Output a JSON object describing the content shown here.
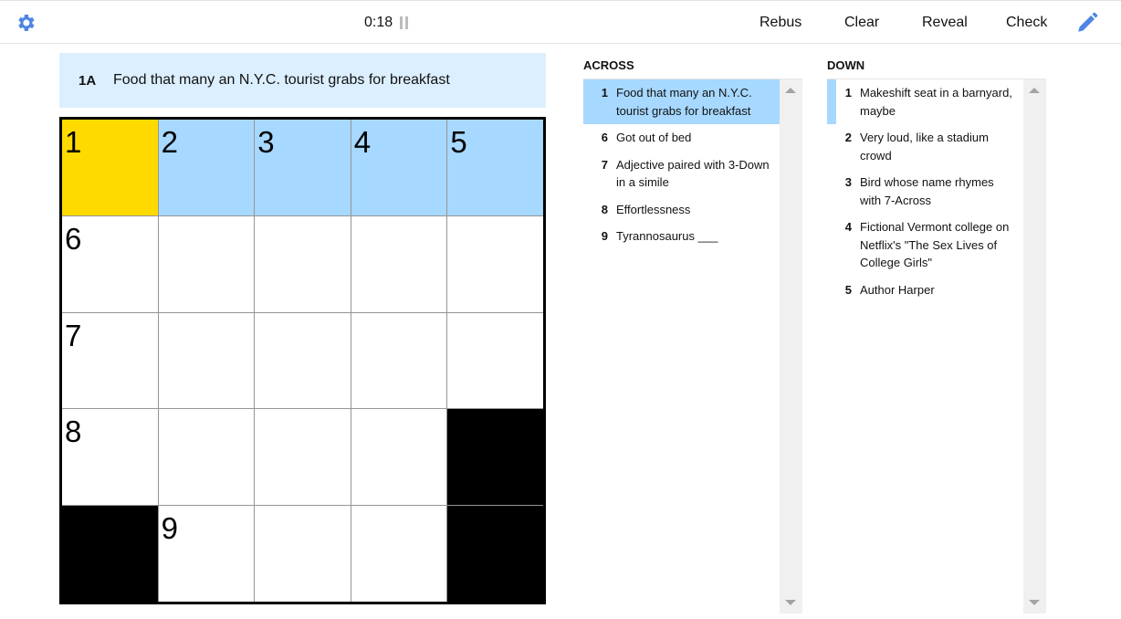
{
  "toolbar": {
    "settings_icon": "gear-icon",
    "timer": "0:18",
    "pause_icon": "pause-icon",
    "buttons": [
      "Rebus",
      "Clear",
      "Reveal",
      "Check"
    ],
    "pencil_icon": "pencil-icon",
    "accent_color": "#4f85e5"
  },
  "current_clue": {
    "label": "1A",
    "text": "Food that many an N.Y.C. tourist grabs for breakfast"
  },
  "grid": {
    "rows": 5,
    "cols": 5,
    "cells": [
      {
        "num": "1",
        "state": "selected"
      },
      {
        "num": "2",
        "state": "word"
      },
      {
        "num": "3",
        "state": "word"
      },
      {
        "num": "4",
        "state": "word"
      },
      {
        "num": "5",
        "state": "word"
      },
      {
        "num": "6",
        "state": "open"
      },
      {
        "num": "",
        "state": "open"
      },
      {
        "num": "",
        "state": "open"
      },
      {
        "num": "",
        "state": "open"
      },
      {
        "num": "",
        "state": "open"
      },
      {
        "num": "7",
        "state": "open"
      },
      {
        "num": "",
        "state": "open"
      },
      {
        "num": "",
        "state": "open"
      },
      {
        "num": "",
        "state": "open"
      },
      {
        "num": "",
        "state": "open"
      },
      {
        "num": "8",
        "state": "open"
      },
      {
        "num": "",
        "state": "open"
      },
      {
        "num": "",
        "state": "open"
      },
      {
        "num": "",
        "state": "open"
      },
      {
        "num": "",
        "state": "black"
      },
      {
        "num": "",
        "state": "black"
      },
      {
        "num": "9",
        "state": "open"
      },
      {
        "num": "",
        "state": "open"
      },
      {
        "num": "",
        "state": "open"
      },
      {
        "num": "",
        "state": "black"
      }
    ],
    "colors": {
      "selected": "#ffda00",
      "word": "#a7d8ff",
      "black": "#000000"
    }
  },
  "across": {
    "title": "ACROSS",
    "clues": [
      {
        "num": "1",
        "text": "Food that many an N.Y.C. tourist grabs for breakfast",
        "state": "active"
      },
      {
        "num": "6",
        "text": "Got out of bed",
        "state": ""
      },
      {
        "num": "7",
        "text": "Adjective paired with 3-Down in a simile",
        "state": ""
      },
      {
        "num": "8",
        "text": "Effortlessness",
        "state": ""
      },
      {
        "num": "9",
        "text": "Tyrannosaurus ___",
        "state": ""
      }
    ]
  },
  "down": {
    "title": "DOWN",
    "clues": [
      {
        "num": "1",
        "text": "Makeshift seat in a barnyard, maybe",
        "state": "cross"
      },
      {
        "num": "2",
        "text": "Very loud, like a stadium crowd",
        "state": ""
      },
      {
        "num": "3",
        "text": "Bird whose name rhymes with 7-Across",
        "state": ""
      },
      {
        "num": "4",
        "text": "Fictional Vermont college on Netflix's \"The Sex Lives of College Girls\"",
        "state": ""
      },
      {
        "num": "5",
        "text": "Author Harper",
        "state": ""
      }
    ]
  }
}
